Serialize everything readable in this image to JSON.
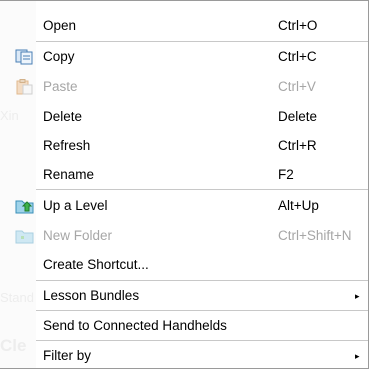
{
  "menu": {
    "items": [
      {
        "label": "Open",
        "shortcut": "Ctrl+O",
        "enabled": true,
        "icon": null
      },
      {
        "label": "Copy",
        "shortcut": "Ctrl+C",
        "enabled": true,
        "icon": "copy-icon"
      },
      {
        "label": "Paste",
        "shortcut": "Ctrl+V",
        "enabled": false,
        "icon": "paste-icon"
      },
      {
        "label": "Delete",
        "shortcut": "Delete",
        "enabled": true,
        "icon": null
      },
      {
        "label": "Refresh",
        "shortcut": "Ctrl+R",
        "enabled": true,
        "icon": null
      },
      {
        "label": "Rename",
        "shortcut": "F2",
        "enabled": true,
        "icon": null
      },
      {
        "label": "Up a Level",
        "shortcut": "Alt+Up",
        "enabled": true,
        "icon": "folder-up-icon"
      },
      {
        "label": "New Folder",
        "shortcut": "Ctrl+Shift+N",
        "enabled": false,
        "icon": "new-folder-icon"
      },
      {
        "label": "Create Shortcut...",
        "shortcut": "",
        "enabled": true,
        "icon": null
      },
      {
        "label": "Lesson Bundles",
        "shortcut": "",
        "enabled": true,
        "icon": null,
        "submenu": true
      },
      {
        "label": "Send to Connected Handhelds",
        "shortcut": "",
        "enabled": true,
        "icon": null
      },
      {
        "label": "Filter by",
        "shortcut": "",
        "enabled": true,
        "icon": null,
        "submenu": true
      }
    ],
    "submenu_arrow": "▸",
    "colors": {
      "disabled": "#a6a6a6",
      "separator": "#c8c8c8",
      "border": "#9a9a9a"
    }
  }
}
